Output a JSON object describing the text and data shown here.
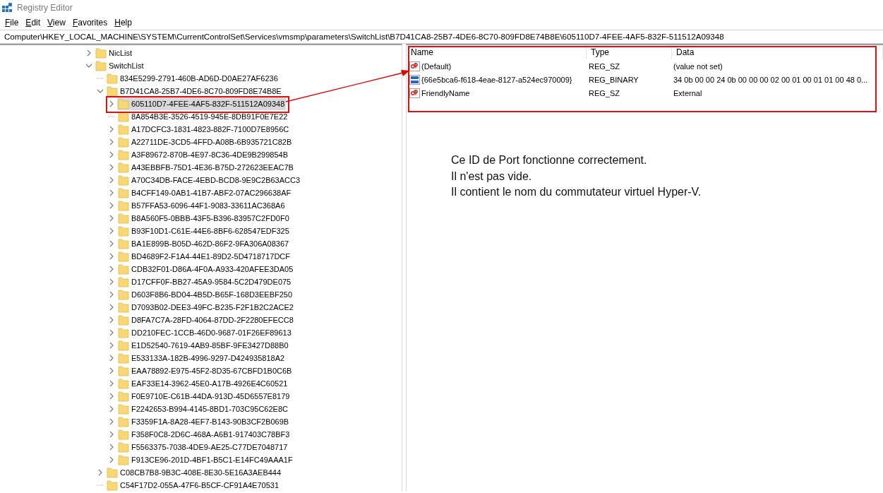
{
  "window": {
    "title": "Registry Editor"
  },
  "menu": [
    "File",
    "Edit",
    "View",
    "Favorites",
    "Help"
  ],
  "address": "Computer\\HKEY_LOCAL_MACHINE\\SYSTEM\\CurrentControlSet\\Services\\vmsmp\\parameters\\SwitchList\\B7D41CA8-25B7-4DE6-8C70-809FD8E74B8E\\605110D7-4FEE-4AF5-832F-511512A09348",
  "tree": [
    {
      "name": "NicList",
      "kind": "branch",
      "expanded": false,
      "selected": false
    },
    {
      "name": "SwitchList",
      "kind": "branch",
      "expanded": true,
      "selected": false,
      "children": [
        {
          "name": "834E5299-2791-460B-AD6D-D0AE27AF6236",
          "kind": "leaf",
          "selected": false
        },
        {
          "name": "B7D41CA8-25B7-4DE6-8C70-809FD8E74B8E",
          "kind": "branch",
          "expanded": true,
          "selected": false,
          "children": [
            {
              "name": "605110D7-4FEE-4AF5-832F-511512A09348",
              "kind": "branch",
              "expanded": false,
              "selected": true
            },
            {
              "name": "8A854B3E-3526-4519-945E-8DB91F0E7E22",
              "kind": "leaf",
              "selected": false
            },
            {
              "name": "A17DCFC3-1831-4823-882F-7100D7E8956C",
              "kind": "branch",
              "expanded": false,
              "selected": false
            },
            {
              "name": "A22711DE-3CD5-4FFD-A08B-6B935721C82B",
              "kind": "branch",
              "expanded": false,
              "selected": false
            },
            {
              "name": "A3F89672-870B-4E97-8C36-4DE9B299854B",
              "kind": "branch",
              "expanded": false,
              "selected": false
            },
            {
              "name": "A43EBBFB-75D1-4E36-B75D-272623EEAC7B",
              "kind": "branch",
              "expanded": false,
              "selected": false
            },
            {
              "name": "A70C34DB-FACE-4EBD-BCD8-9E9C2B63ACC3",
              "kind": "branch",
              "expanded": false,
              "selected": false
            },
            {
              "name": "B4CFF149-0AB1-41B7-ABF2-07AC296638AF",
              "kind": "branch",
              "expanded": false,
              "selected": false
            },
            {
              "name": "B57FFA53-6096-44F1-9083-33611AC368A6",
              "kind": "branch",
              "expanded": false,
              "selected": false
            },
            {
              "name": "B8A560F5-0BBB-43F5-B396-83957C2FD0F0",
              "kind": "branch",
              "expanded": false,
              "selected": false
            },
            {
              "name": "B93F10D1-C61E-44E6-8BF6-628547EDF325",
              "kind": "branch",
              "expanded": false,
              "selected": false
            },
            {
              "name": "BA1E899B-B05D-462D-86F2-9FA306A08367",
              "kind": "branch",
              "expanded": false,
              "selected": false
            },
            {
              "name": "BD4689F2-F1A4-44E1-89D2-5D4718717DCF",
              "kind": "branch",
              "expanded": false,
              "selected": false
            },
            {
              "name": "CDB32F01-D86A-4F0A-A933-420AFEE3DA05",
              "kind": "branch",
              "expanded": false,
              "selected": false
            },
            {
              "name": "D17CFF0F-BB27-45A9-9584-5C2D479DE075",
              "kind": "branch",
              "expanded": false,
              "selected": false
            },
            {
              "name": "D603F8B6-BD04-4B5D-B65F-168D3EEBF250",
              "kind": "branch",
              "expanded": false,
              "selected": false
            },
            {
              "name": "D7093B02-DEE3-49FC-B235-F2F1B2C2ACE2",
              "kind": "branch",
              "expanded": false,
              "selected": false
            },
            {
              "name": "D8FA7C7A-28FD-4064-87DD-2F2280EFECC8",
              "kind": "branch",
              "expanded": false,
              "selected": false
            },
            {
              "name": "DD210FEC-1CCB-46D0-9687-01F26EF89613",
              "kind": "branch",
              "expanded": false,
              "selected": false
            },
            {
              "name": "E1D52540-7619-4AB9-85BF-9FE3427D88B0",
              "kind": "branch",
              "expanded": false,
              "selected": false
            },
            {
              "name": "E533133A-182B-4996-9297-D424935818A2",
              "kind": "branch",
              "expanded": false,
              "selected": false
            },
            {
              "name": "EAA78892-E975-45F2-8D35-67CBFD1B0C6B",
              "kind": "branch",
              "expanded": false,
              "selected": false
            },
            {
              "name": "EAF33E14-3962-45E0-A17B-4926E4C60521",
              "kind": "branch",
              "expanded": false,
              "selected": false
            },
            {
              "name": "F0E9710E-C61B-44DA-913D-45D6557E8179",
              "kind": "branch",
              "expanded": false,
              "selected": false
            },
            {
              "name": "F2242653-B994-4145-8BD1-703C95C62E8C",
              "kind": "branch",
              "expanded": false,
              "selected": false
            },
            {
              "name": "F3359F1A-8A28-4EF7-B143-90B3CF2B069B",
              "kind": "branch",
              "expanded": false,
              "selected": false
            },
            {
              "name": "F358F0C8-2D6C-468A-A6B1-917403C78BF3",
              "kind": "branch",
              "expanded": false,
              "selected": false
            },
            {
              "name": "F5563375-7038-4DE9-AE25-C77DE7048717",
              "kind": "branch",
              "expanded": false,
              "selected": false
            },
            {
              "name": "F913CE96-201D-4BF1-B5C1-E14FC49AAA1F",
              "kind": "branch",
              "expanded": false,
              "selected": false
            }
          ]
        },
        {
          "name": "C08CB7B8-9B3C-408E-8E30-5E16A3AEB444",
          "kind": "branch",
          "expanded": false,
          "selected": false
        },
        {
          "name": "C54F17D2-055A-47F6-B5CF-CF91A4E70531",
          "kind": "leaf",
          "selected": false
        }
      ]
    }
  ],
  "values": {
    "columns": [
      "Name",
      "Type",
      "Data"
    ],
    "rows": [
      {
        "kind": "string",
        "name": "(Default)",
        "type": "REG_SZ",
        "data": "(value not set)"
      },
      {
        "kind": "binary",
        "name": "{66e5bca6-f618-4eae-8127-a524ec970009}",
        "type": "REG_BINARY",
        "data": "34 0b 00 00 24 0b 00 00 00 02 00 01 00 01 01 00 48 0..."
      },
      {
        "kind": "string",
        "name": "FriendlyName",
        "type": "REG_SZ",
        "data": "External"
      }
    ]
  },
  "note": [
    "Ce ID de Port fonctionne correctement.",
    "Il n'est pas vide.",
    "Il contient le nom du commutateur virtuel Hyper-V."
  ]
}
